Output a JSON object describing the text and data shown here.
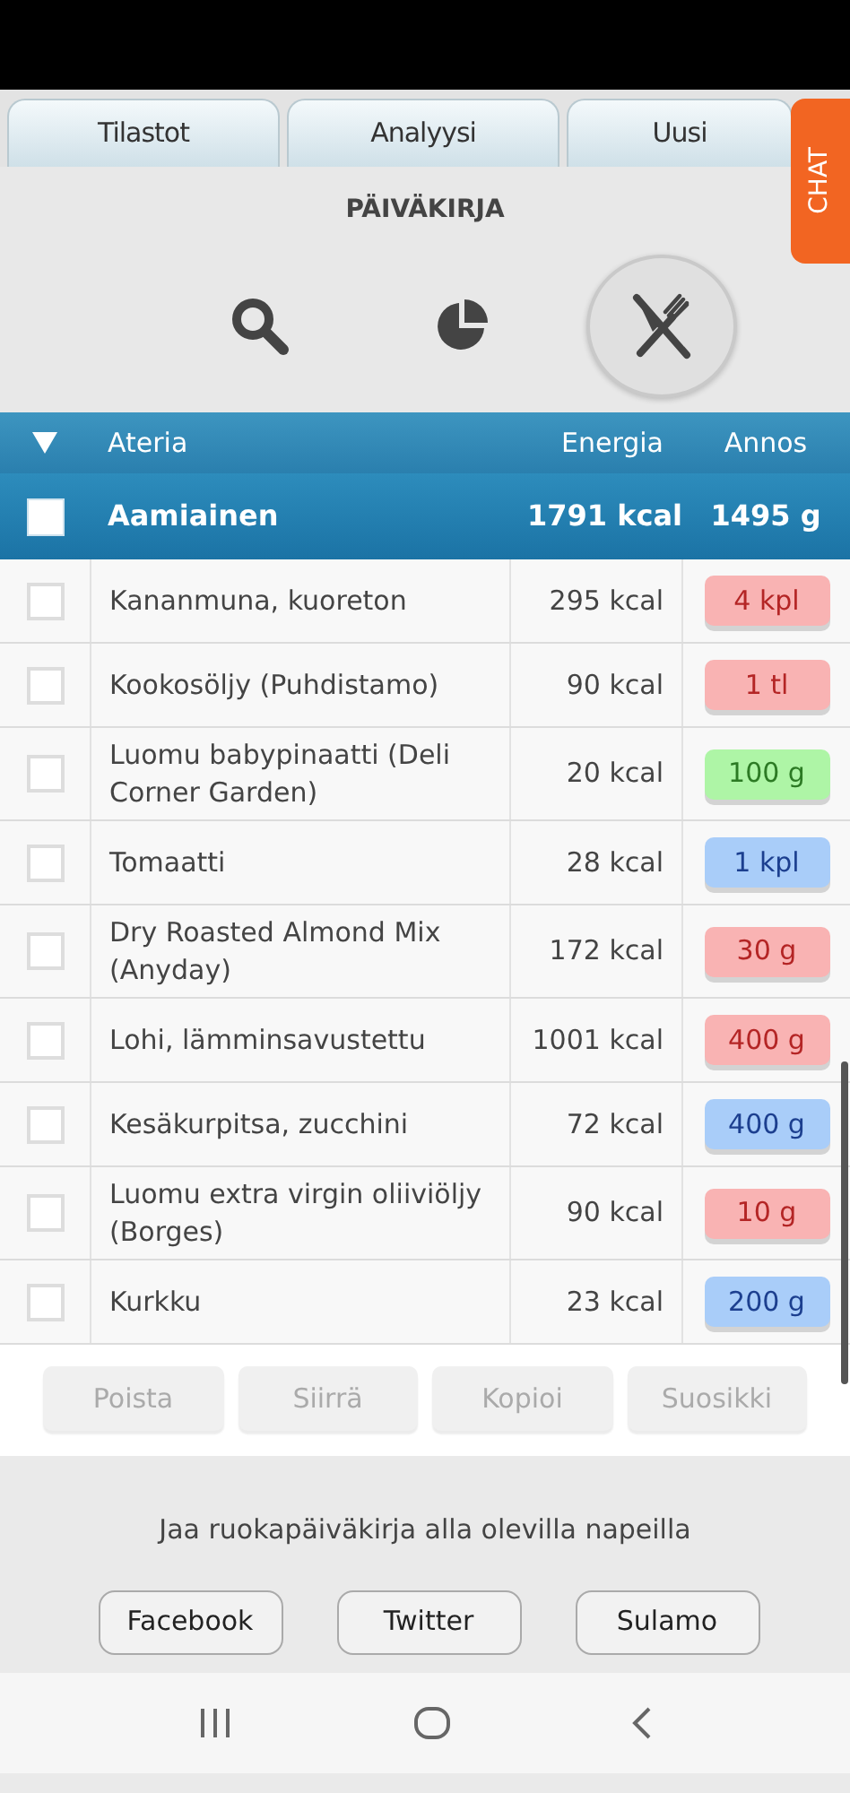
{
  "tabs": [
    {
      "label": "Tilastot"
    },
    {
      "label": "Analyysi"
    },
    {
      "label": "Uusi"
    }
  ],
  "chat_tab": {
    "label": "CHAT"
  },
  "title": "PÄIVÄKIRJA",
  "view_icons": [
    {
      "kind": "search",
      "selected": false
    },
    {
      "kind": "chart",
      "selected": false
    },
    {
      "kind": "meal",
      "selected": true
    }
  ],
  "table": {
    "columns": [
      "Ateria",
      "Energia",
      "Annos"
    ],
    "meal": {
      "name": "Aamiainen",
      "energy": "1791 kcal",
      "portion": "1495 g",
      "checked": false
    },
    "rows": [
      {
        "name": "Kananmuna, kuoreton",
        "energy": "295 kcal",
        "portion": "4 kpl",
        "color": "#f9b3b3",
        "checked": false
      },
      {
        "name": "Kookosöljy (Puhdistamo)",
        "energy": "90 kcal",
        "portion": "1 tl",
        "color": "#f9b3b3",
        "checked": false
      },
      {
        "name": "Luomu babypinaatti (Deli Corner Garden)",
        "energy": "20 kcal",
        "portion": "100 g",
        "color": "#aef5a6",
        "checked": false
      },
      {
        "name": "Tomaatti",
        "energy": "28 kcal",
        "portion": "1 kpl",
        "color": "#a9cdf9",
        "checked": false
      },
      {
        "name": "Dry Roasted Almond Mix (Anyday)",
        "energy": "172 kcal",
        "portion": "30 g",
        "color": "#f9b3b3",
        "checked": false
      },
      {
        "name": "Lohi, lämminsavustettu",
        "energy": "1001 kcal",
        "portion": "400 g",
        "color": "#f9b3b3",
        "checked": false
      },
      {
        "name": "Kesäkurpitsa, zucchini",
        "energy": "72 kcal",
        "portion": "400 g",
        "color": "#a9cdf9",
        "checked": false
      },
      {
        "name": "Luomu extra virgin oliiviöljy (Borges)",
        "energy": "90 kcal",
        "portion": "10 g",
        "color": "#f9b3b3",
        "checked": false
      },
      {
        "name": "Kurkku",
        "energy": "23 kcal",
        "portion": "200 g",
        "color": "#a9cdf9",
        "checked": false
      }
    ]
  },
  "actions": [
    {
      "label": "Poista",
      "disabled": true
    },
    {
      "label": "Siirrä",
      "disabled": true
    },
    {
      "label": "Kopioi",
      "disabled": true
    },
    {
      "label": "Suosikki",
      "disabled": true
    }
  ],
  "share": {
    "text": "Jaa ruokapäiväkirja alla olevilla napeilla",
    "buttons": [
      "Facebook",
      "Twitter",
      "Sulamo"
    ]
  }
}
